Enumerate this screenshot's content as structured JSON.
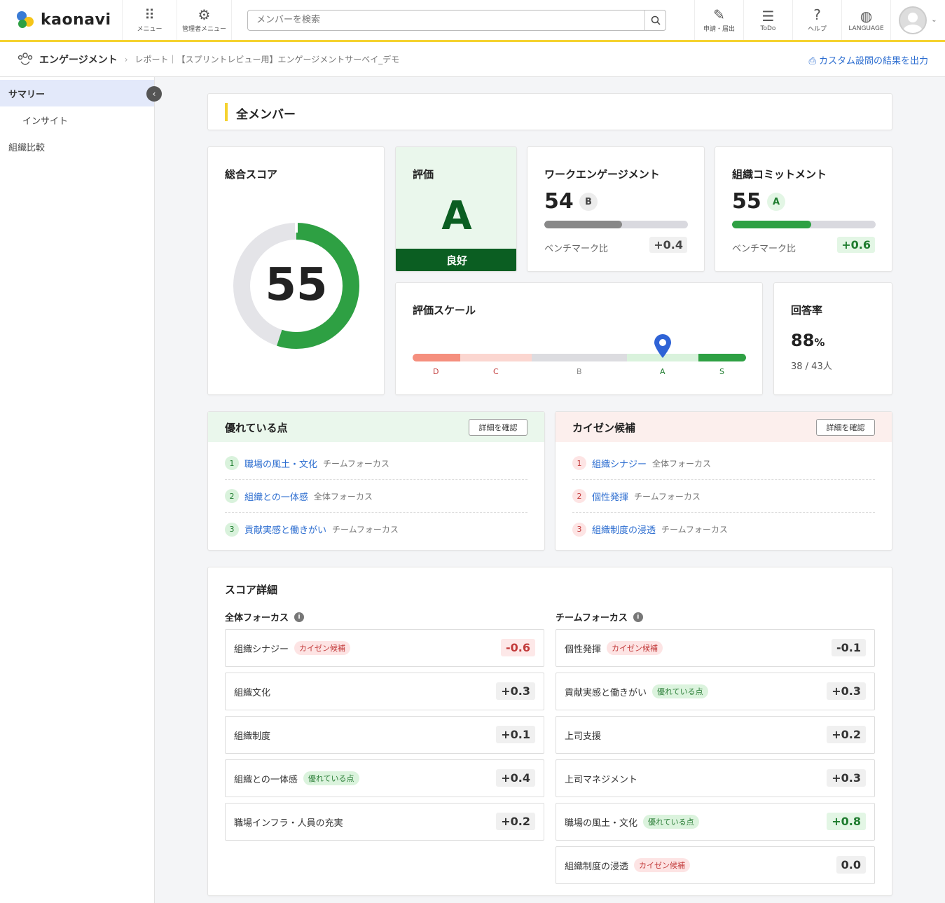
{
  "header": {
    "logo_text": "kaonavi",
    "menu_label": "メニュー",
    "admin_menu_label": "管理者メニュー",
    "search_placeholder": "メンバーを検索",
    "requests_label": "申請・届出",
    "todo_label": "ToDo",
    "help_label": "ヘルプ",
    "language_label": "LANGUAGE"
  },
  "subheader": {
    "title": "エンゲージメント",
    "breadcrumb": "レポート｜【スプリントレビュー用】エンゲージメントサーベイ_デモ",
    "export_label": "カスタム設問の結果を出力"
  },
  "sidebar": {
    "items": [
      {
        "label": "サマリー"
      },
      {
        "label": "インサイト"
      },
      {
        "label": "組織比較"
      }
    ]
  },
  "section_title": "全メンバー",
  "overall": {
    "title": "総合スコア",
    "score": "55",
    "fraction": 0.55,
    "color": "#2ea043"
  },
  "grade": {
    "title": "評価",
    "letter": "A",
    "label": "良好"
  },
  "work_engagement": {
    "title": "ワークエンゲージメント",
    "score": "54",
    "grade": "B",
    "fraction": 0.54,
    "bench_label": "ベンチマーク比",
    "delta": "+0.4"
  },
  "org_commitment": {
    "title": "組織コミットメント",
    "score": "55",
    "grade": "A",
    "fraction": 0.55,
    "bench_label": "ベンチマーク比",
    "delta": "+0.6"
  },
  "scale": {
    "title": "評価スケール",
    "labels": [
      "D",
      "C",
      "B",
      "A",
      "S"
    ],
    "marker_grade": "A"
  },
  "response": {
    "title": "回答率",
    "value": "88",
    "unit": "%",
    "detail": "38 / 43人"
  },
  "strengths": {
    "title": "優れている点",
    "button": "詳細を確認",
    "items": [
      {
        "num": "1",
        "name": "職場の風土・文化",
        "focus": "チームフォーカス"
      },
      {
        "num": "2",
        "name": "組織との一体感",
        "focus": "全体フォーカス"
      },
      {
        "num": "3",
        "name": "貢献実感と働きがい",
        "focus": "チームフォーカス"
      }
    ]
  },
  "kaizen": {
    "title": "カイゼン候補",
    "button": "詳細を確認",
    "items": [
      {
        "num": "1",
        "name": "組織シナジー",
        "focus": "全体フォーカス"
      },
      {
        "num": "2",
        "name": "個性発揮",
        "focus": "チームフォーカス"
      },
      {
        "num": "3",
        "name": "組織制度の浸透",
        "focus": "チームフォーカス"
      }
    ]
  },
  "score_detail": {
    "title": "スコア詳細",
    "overall_focus": {
      "title": "全体フォーカス",
      "rows": [
        {
          "name": "組織シナジー",
          "tag": "カイゼン候補",
          "tag_type": "kaizen",
          "value": "-0.6",
          "tone": "neg"
        },
        {
          "name": "組織文化",
          "tag": "",
          "tag_type": "",
          "value": "+0.3",
          "tone": ""
        },
        {
          "name": "組織制度",
          "tag": "",
          "tag_type": "",
          "value": "+0.1",
          "tone": ""
        },
        {
          "name": "組織との一体感",
          "tag": "優れている点",
          "tag_type": "good",
          "value": "+0.4",
          "tone": ""
        },
        {
          "name": "職場インフラ・人員の充実",
          "tag": "",
          "tag_type": "",
          "value": "+0.2",
          "tone": ""
        }
      ]
    },
    "team_focus": {
      "title": "チームフォーカス",
      "rows": [
        {
          "name": "個性発揮",
          "tag": "カイゼン候補",
          "tag_type": "kaizen",
          "value": "-0.1",
          "tone": ""
        },
        {
          "name": "貢献実感と働きがい",
          "tag": "優れている点",
          "tag_type": "good",
          "value": "+0.3",
          "tone": ""
        },
        {
          "name": "上司支援",
          "tag": "",
          "tag_type": "",
          "value": "+0.2",
          "tone": ""
        },
        {
          "name": "上司マネジメント",
          "tag": "",
          "tag_type": "",
          "value": "+0.3",
          "tone": ""
        },
        {
          "name": "職場の風土・文化",
          "tag": "優れている点",
          "tag_type": "good",
          "value": "+0.8",
          "tone": "pos"
        },
        {
          "name": "組織制度の浸透",
          "tag": "カイゼン候補",
          "tag_type": "kaizen",
          "value": "0.0",
          "tone": ""
        }
      ]
    }
  }
}
